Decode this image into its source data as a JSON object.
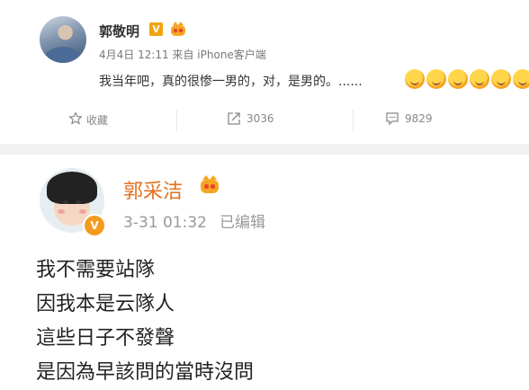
{
  "post1": {
    "username": "郭敬明",
    "verified_badge": "V",
    "meta": "4月4日 12:11 来自 iPhone客户端",
    "text": "我当年吧，真的很惨一男的，对，是男的。......",
    "emoji_count": 6,
    "actions": {
      "favorite_label": "收藏",
      "repost_count": "3036",
      "comment_count": "9829"
    }
  },
  "post2": {
    "username": "郭采洁",
    "verified_badge": "V",
    "time": "3-31 01:32",
    "edited_label": "已编辑",
    "lines": [
      "我不需要站隊",
      "因我本是云隊人",
      "這些日子不發聲",
      "是因為早該問的當時沒問"
    ]
  },
  "colors": {
    "name_accent": "#e3701e",
    "badge": "#f39a1f",
    "meta_gray": "#999999"
  }
}
